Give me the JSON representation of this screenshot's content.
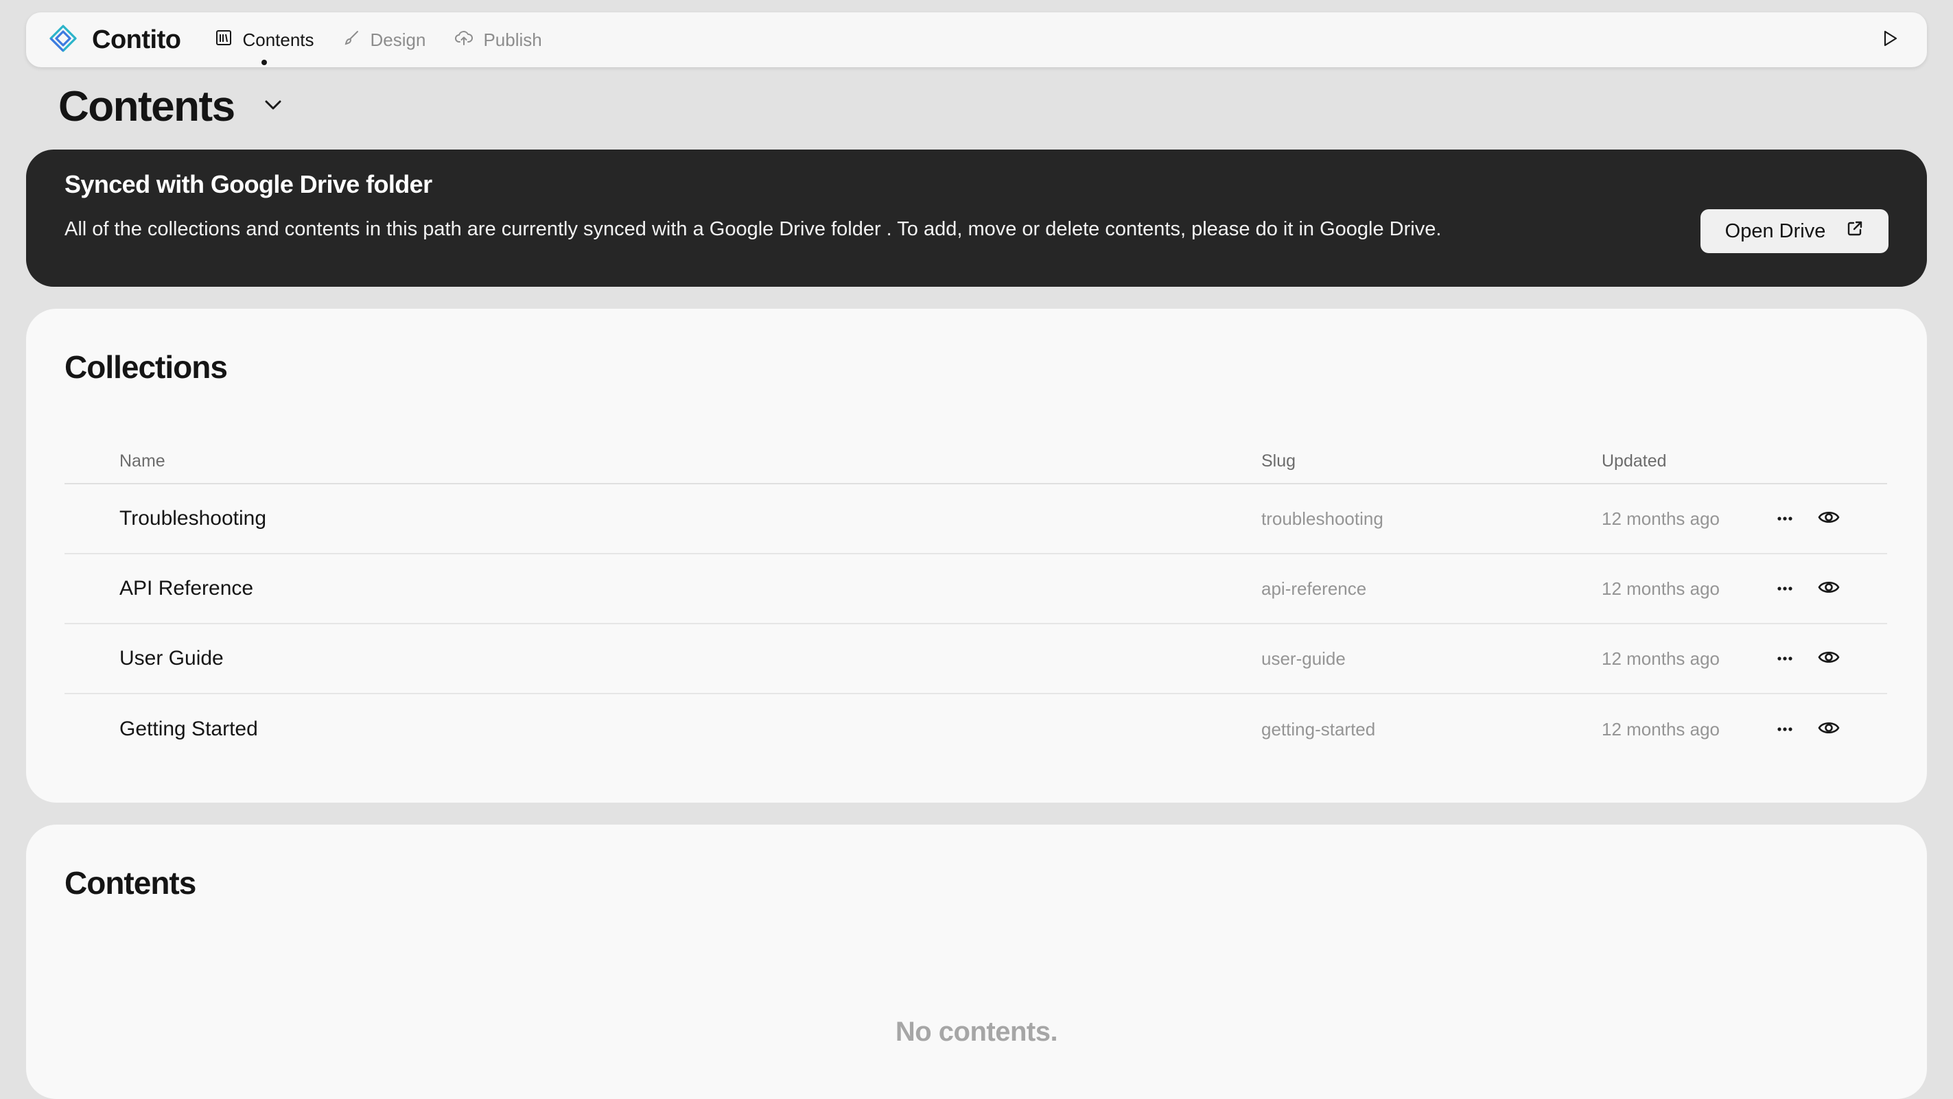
{
  "app": {
    "name": "Contito",
    "brand_colors": [
      "#2bb4c9",
      "#3d7be0"
    ]
  },
  "nav": {
    "items": [
      {
        "label": "Contents",
        "icon": "library-icon",
        "active": true
      },
      {
        "label": "Design",
        "icon": "brush-icon",
        "active": false
      },
      {
        "label": "Publish",
        "icon": "cloud-upload-icon",
        "active": false
      }
    ],
    "preview_icon": "play-icon"
  },
  "page": {
    "title": "Contents"
  },
  "banner": {
    "title": "Synced with Google Drive folder",
    "text": "All of the collections and contents in this path are currently synced with a Google Drive folder . To add, move or delete contents, please do it in Google Drive.",
    "button_label": "Open Drive"
  },
  "collections": {
    "title": "Collections",
    "columns": {
      "name": "Name",
      "slug": "Slug",
      "updated": "Updated"
    },
    "rows": [
      {
        "name": "Troubleshooting",
        "slug": "troubleshooting",
        "updated": "12 months ago"
      },
      {
        "name": "API Reference",
        "slug": "api-reference",
        "updated": "12 months ago"
      },
      {
        "name": "User Guide",
        "slug": "user-guide",
        "updated": "12 months ago"
      },
      {
        "name": "Getting Started",
        "slug": "getting-started",
        "updated": "12 months ago"
      }
    ]
  },
  "contents": {
    "title": "Contents",
    "empty_text": "No contents."
  }
}
